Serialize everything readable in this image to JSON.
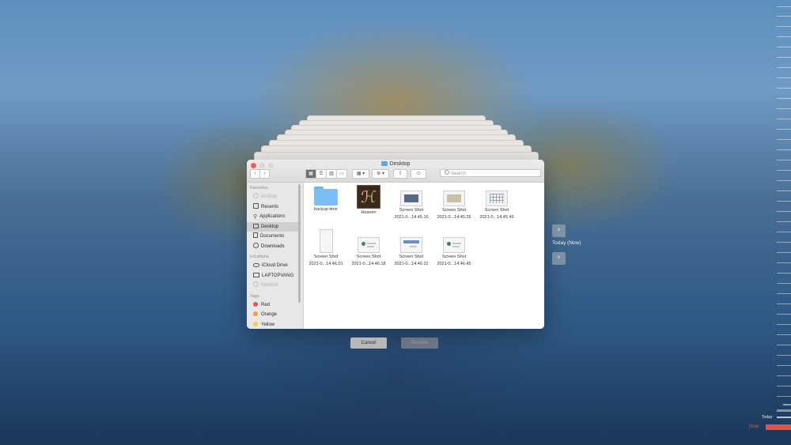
{
  "window": {
    "title": "Desktop",
    "search_placeholder": "Search"
  },
  "sidebar": {
    "favorites_header": "Favorites",
    "favorites": [
      {
        "label": "AirDrop",
        "icon": "airdrop-icon",
        "disabled": true
      },
      {
        "label": "Recents",
        "icon": "clock-icon"
      },
      {
        "label": "Applications",
        "icon": "applications-icon"
      },
      {
        "label": "Desktop",
        "icon": "desktop-icon",
        "selected": true
      },
      {
        "label": "Documents",
        "icon": "document-icon"
      },
      {
        "label": "Downloads",
        "icon": "download-icon"
      }
    ],
    "locations_header": "Locations",
    "locations": [
      {
        "label": "iCloud Drive",
        "icon": "cloud-icon"
      },
      {
        "label": "LAPTOPVANG",
        "icon": "laptop-icon"
      },
      {
        "label": "Network",
        "icon": "globe-icon",
        "disabled": true
      }
    ],
    "tags_header": "Tags",
    "tags": [
      {
        "label": "Red",
        "color": "#e8554c"
      },
      {
        "label": "Orange",
        "color": "#f0a030"
      },
      {
        "label": "Yellow",
        "color": "#f5d040"
      }
    ]
  },
  "files": [
    {
      "name": "backup time",
      "line2": ""
    },
    {
      "name": "Heaven",
      "line2": ""
    },
    {
      "name": "Screen Shot",
      "line2": "2021-0...14.45.16"
    },
    {
      "name": "Screen Shot",
      "line2": "2021-0...14.45.25"
    },
    {
      "name": "Screen Shot",
      "line2": "2021-0...14.45.49"
    },
    {
      "name": "Screen Shot",
      "line2": "2021-0...14.46.01"
    },
    {
      "name": "Screen Shot",
      "line2": "2021-0...14.46.18"
    },
    {
      "name": "Screen Shot",
      "line2": "2021-0...14.46.31"
    },
    {
      "name": "Screen Shot",
      "line2": "2021-0...14.46.45"
    }
  ],
  "dialog": {
    "cancel_label": "Cancel",
    "restore_label": "Restore"
  },
  "navigation": {
    "current_label": "Today (Now)"
  },
  "timeline": {
    "today_label": "Today",
    "now_label": "Now",
    "now_color": "#e35247"
  }
}
